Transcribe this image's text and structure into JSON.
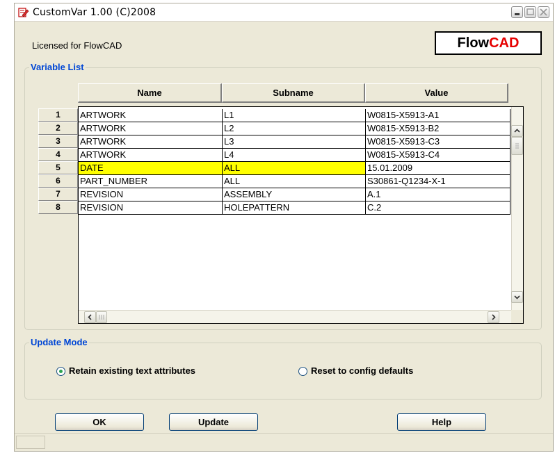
{
  "window": {
    "title": "CustomVar 1.00 (C)2008",
    "licensed_text": "Licensed for FlowCAD",
    "logo": {
      "part1": "Flow",
      "part2": "CAD",
      "colors": {
        "part1": "#000000",
        "part2": "#e60000"
      }
    }
  },
  "variable_list": {
    "legend": "Variable List",
    "columns": [
      "Name",
      "Subname",
      "Value"
    ],
    "rows": [
      {
        "num": "1",
        "name": "ARTWORK",
        "subname": "L1",
        "value": "W0815-X5913-A1"
      },
      {
        "num": "2",
        "name": "ARTWORK",
        "subname": "L2",
        "value": "W0815-X5913-B2"
      },
      {
        "num": "3",
        "name": "ARTWORK",
        "subname": "L3",
        "value": "W0815-X5913-C3"
      },
      {
        "num": "4",
        "name": "ARTWORK",
        "subname": "L4",
        "value": "W0815-X5913-C4"
      },
      {
        "num": "5",
        "name": "DATE",
        "subname": "ALL",
        "value": "15.01.2009",
        "highlight": true
      },
      {
        "num": "6",
        "name": "PART_NUMBER",
        "subname": "ALL",
        "value": "S30861-Q1234-X-1"
      },
      {
        "num": "7",
        "name": "REVISION",
        "subname": "ASSEMBLY",
        "value": "A.1"
      },
      {
        "num": "8",
        "name": "REVISION",
        "subname": "HOLEPATTERN",
        "value": "C.2"
      }
    ],
    "highlight_color": "#ffff00"
  },
  "update_mode": {
    "legend": "Update Mode",
    "options": [
      {
        "label": "Retain existing text attributes",
        "selected": true
      },
      {
        "label": "Reset to config defaults",
        "selected": false
      }
    ]
  },
  "buttons": {
    "ok": "OK",
    "update": "Update",
    "help": "Help"
  },
  "accent_color": "#0046d5"
}
